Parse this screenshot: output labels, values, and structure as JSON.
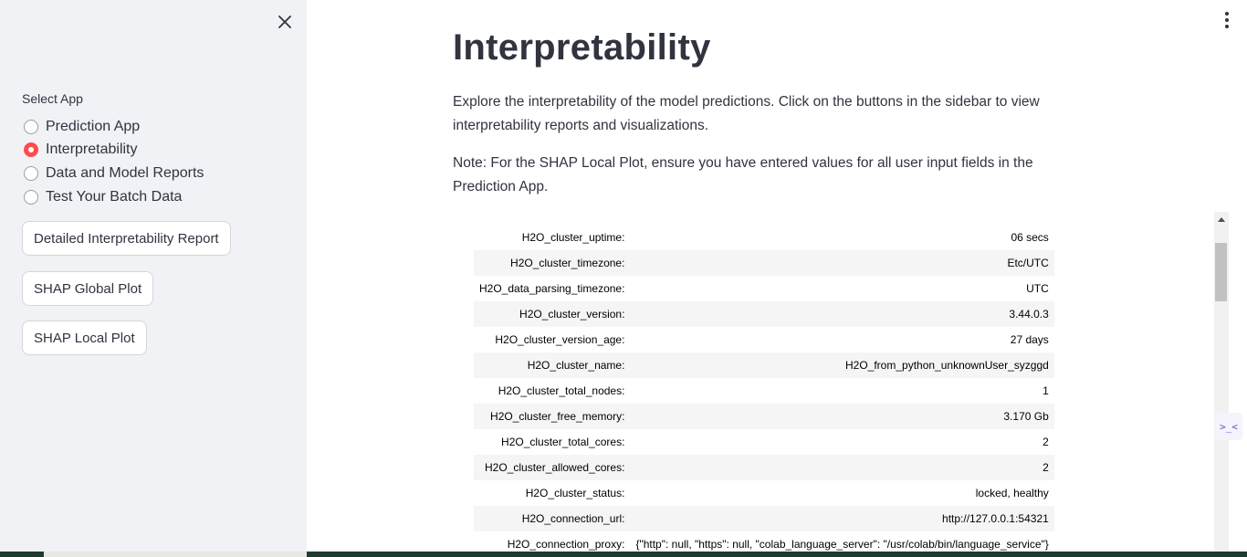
{
  "sidebar": {
    "select_label": "Select App",
    "radio_options": [
      {
        "label": "Prediction App",
        "selected": false
      },
      {
        "label": "Interpretability",
        "selected": true
      },
      {
        "label": "Data and Model Reports",
        "selected": false
      },
      {
        "label": "Test Your Batch Data",
        "selected": false
      }
    ],
    "buttons": [
      {
        "label": "Detailed Interpretability Report"
      },
      {
        "label": "SHAP Global Plot"
      },
      {
        "label": "SHAP Local Plot"
      }
    ],
    "close_icon": "close-icon"
  },
  "main": {
    "title": "Interpretability",
    "description": "Explore the interpretability of the model predictions. Click on the buttons in the sidebar to view interpretability reports and visualizations.",
    "note": "Note: For the SHAP Local Plot, ensure you have entered values for all user input fields in the Prediction App.",
    "menu_icon": "kebab-menu-icon"
  },
  "cluster_info": [
    {
      "key": "H2O_cluster_uptime:",
      "value": "06 secs"
    },
    {
      "key": "H2O_cluster_timezone:",
      "value": "Etc/UTC"
    },
    {
      "key": "H2O_data_parsing_timezone:",
      "value": "UTC"
    },
    {
      "key": "H2O_cluster_version:",
      "value": "3.44.0.3"
    },
    {
      "key": "H2O_cluster_version_age:",
      "value": "27 days"
    },
    {
      "key": "H2O_cluster_name:",
      "value": "H2O_from_python_unknownUser_syzggd"
    },
    {
      "key": "H2O_cluster_total_nodes:",
      "value": "1"
    },
    {
      "key": "H2O_cluster_free_memory:",
      "value": "3.170 Gb"
    },
    {
      "key": "H2O_cluster_total_cores:",
      "value": "2"
    },
    {
      "key": "H2O_cluster_allowed_cores:",
      "value": "2"
    },
    {
      "key": "H2O_cluster_status:",
      "value": "locked, healthy"
    },
    {
      "key": "H2O_connection_url:",
      "value": "http://127.0.0.1:54321"
    },
    {
      "key": "H2O_connection_proxy:",
      "value": "{\"http\": null, \"https\": null, \"colab_language_server\": \"/usr/colab/bin/language_service\"}"
    }
  ],
  "side_tool": {
    "label": ">_<",
    "icon": "code-tool-icon"
  },
  "colors": {
    "accent": "#ff4b4b",
    "sidebar_bg": "#f0f2f6",
    "text": "#31333f"
  }
}
